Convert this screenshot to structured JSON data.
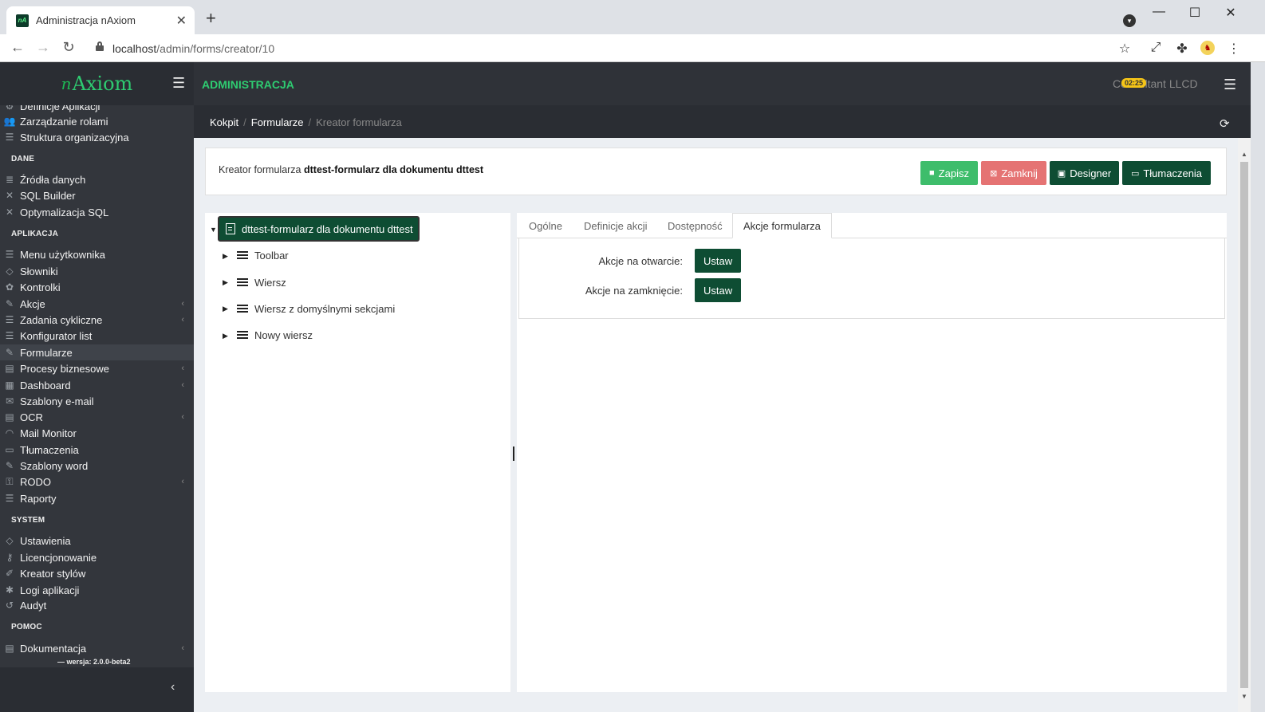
{
  "browser": {
    "tab_title": "Administracja nAxiom",
    "tab_favicon": "nA",
    "url_host": "localhost",
    "url_path": "/admin/forms/creator/10"
  },
  "header": {
    "brand_n": "n",
    "brand_name": "Axiom",
    "title": "ADMINISTRACJA",
    "timer": "02:25",
    "user": "Consultant LLCD"
  },
  "sidebar": {
    "partial_item": "Definicje Aplikacji",
    "items_top": [
      {
        "label": "Zarządzanie rolami",
        "icon": "users-icon"
      },
      {
        "label": "Struktura organizacyjna",
        "icon": "list-icon"
      }
    ],
    "sections": {
      "dane": "DANE",
      "aplikacja": "APLIKACJA",
      "system": "SYSTEM",
      "pomoc": "POMOC"
    },
    "dane_items": [
      "Źródła danych",
      "SQL Builder",
      "Optymalizacja SQL"
    ],
    "aplikacja_items": [
      "Menu użytkownika",
      "Słowniki",
      "Kontrolki",
      "Akcje",
      "Zadania cykliczne",
      "Konfigurator list",
      "Formularze",
      "Procesy biznesowe",
      "Dashboard",
      "Szablony e-mail",
      "OCR",
      "Mail Monitor",
      "Tłumaczenia",
      "Szablony word",
      "RODO",
      "Raporty"
    ],
    "system_items": [
      "Ustawienia",
      "Licencjonowanie",
      "Kreator stylów",
      "Logi aplikacji",
      "Audyt"
    ],
    "pomoc_items": [
      "Dokumentacja"
    ],
    "version": "— wersja: 2.0.0-beta2"
  },
  "breadcrumb": {
    "items": [
      "Kokpit",
      "Formularze"
    ],
    "current": "Kreator formularza"
  },
  "page": {
    "title_prefix": "Kreator formularza",
    "title_name": "dttest-formularz dla dokumentu dttest",
    "buttons": {
      "save": "Zapisz",
      "close": "Zamknij",
      "designer": "Designer",
      "translations": "Tłumaczenia"
    },
    "colors": {
      "save": "#3ebd6b",
      "close": "#e57373",
      "dark_green": "#0e4d33"
    }
  },
  "tree": {
    "root": "dttest-formularz dla dokumentu dttest",
    "nodes": [
      "Toolbar",
      "Wiersz",
      "Wiersz z domyślnymi sekcjami",
      "Nowy wiersz"
    ]
  },
  "tabs": {
    "items": [
      "Ogólne",
      "Definicje akcji",
      "Dostępność",
      "Akcje formularza"
    ],
    "active": "Akcje formularza"
  },
  "form_actions": {
    "on_open_label": "Akcje na otwarcie:",
    "on_close_label": "Akcje na zamknięcie:",
    "set_label": "Ustaw"
  }
}
